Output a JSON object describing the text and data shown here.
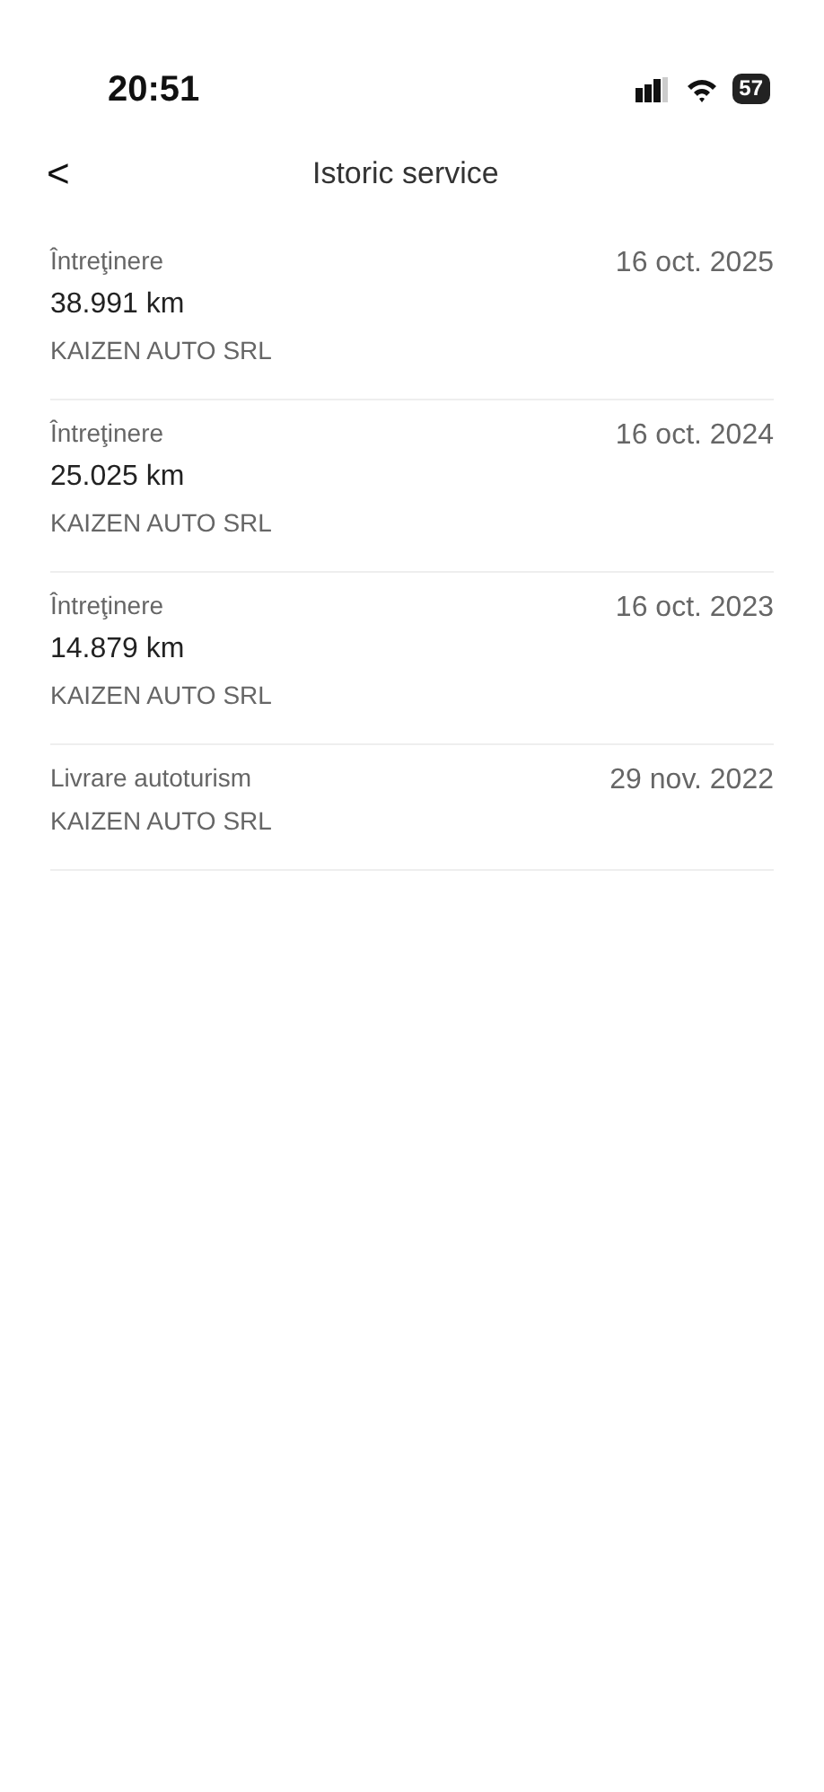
{
  "status_bar": {
    "time": "20:51",
    "battery": "57"
  },
  "header": {
    "back": "<",
    "title": "Istoric service"
  },
  "entries": [
    {
      "type": "Întreţinere",
      "mileage": "38.991 km",
      "provider": "KAIZEN AUTO SRL",
      "date": "16 oct. 2025"
    },
    {
      "type": "Întreţinere",
      "mileage": "25.025 km",
      "provider": "KAIZEN AUTO SRL",
      "date": "16 oct. 2024"
    },
    {
      "type": "Întreţinere",
      "mileage": "14.879 km",
      "provider": "KAIZEN AUTO SRL",
      "date": "16 oct. 2023"
    },
    {
      "type": "Livrare autoturism",
      "provider": "KAIZEN AUTO SRL",
      "date": "29 nov. 2022"
    }
  ]
}
